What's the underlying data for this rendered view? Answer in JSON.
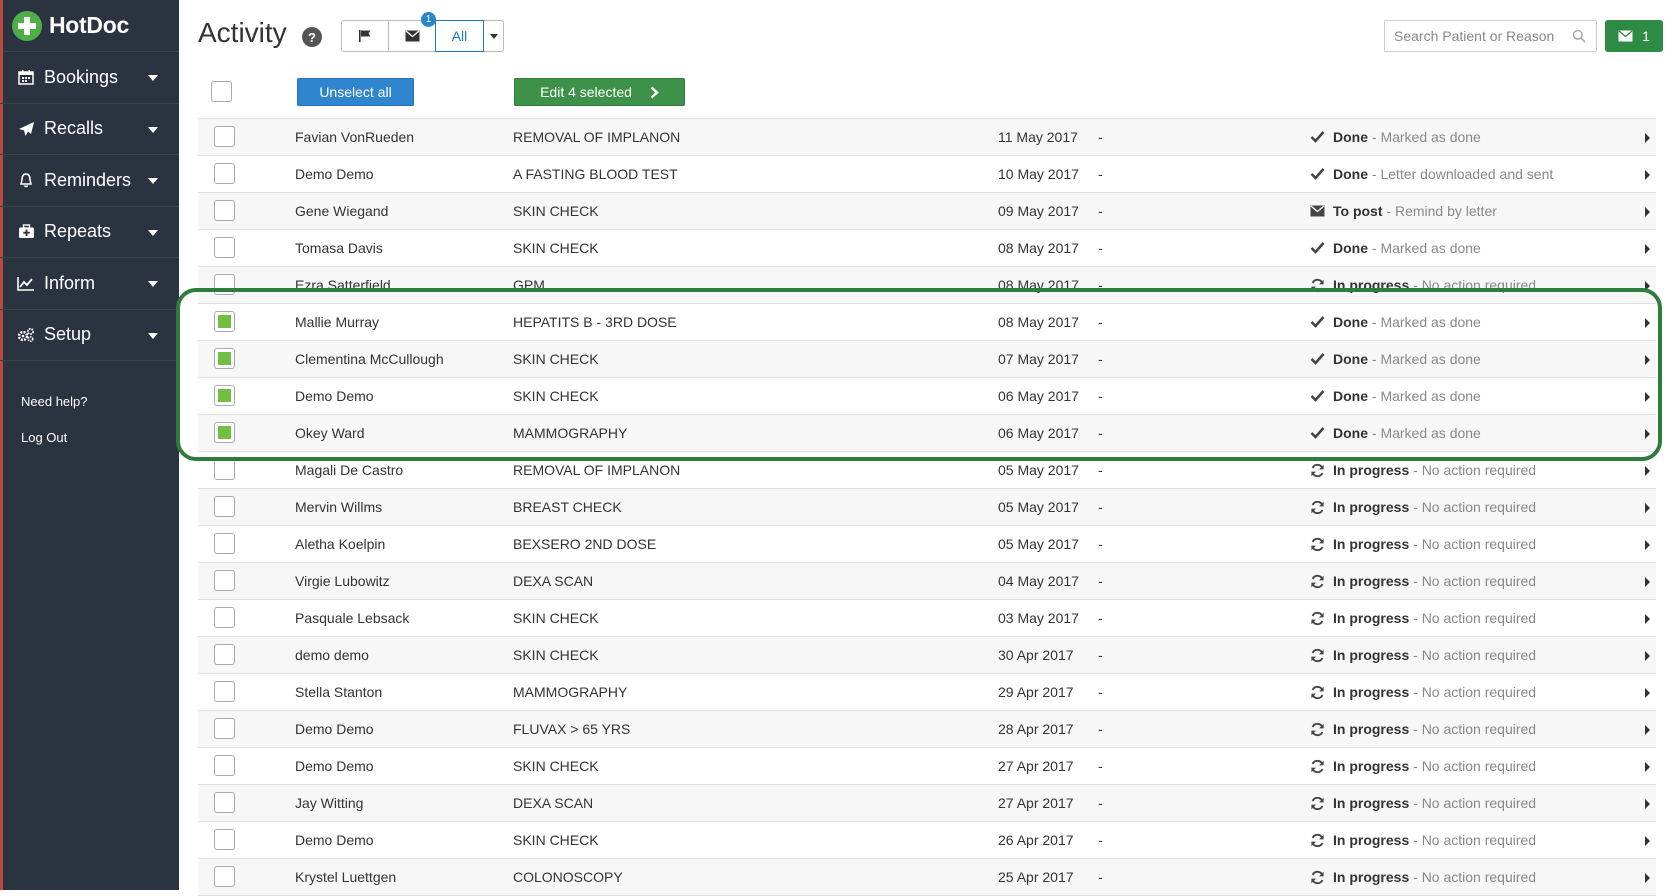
{
  "brand": {
    "name": "HotDoc"
  },
  "sidebar": {
    "items": [
      {
        "label": "Bookings",
        "icon": "calendar-icon"
      },
      {
        "label": "Recalls",
        "icon": "paper-plane-icon"
      },
      {
        "label": "Reminders",
        "icon": "bell-icon"
      },
      {
        "label": "Repeats",
        "icon": "medkit-icon"
      },
      {
        "label": "Inform",
        "icon": "line-chart-icon"
      },
      {
        "label": "Setup",
        "icon": "cogs-icon"
      }
    ],
    "links": [
      {
        "label": "Need help?"
      },
      {
        "label": "Log Out"
      }
    ]
  },
  "header": {
    "title": "Activity",
    "help": "?",
    "filters": {
      "all_label": "All",
      "mail_badge": "1"
    },
    "search_placeholder": "Search Patient or Reason",
    "messages_count": "1"
  },
  "toolbar": {
    "unselect_label": "Unselect all",
    "edit_label": "Edit 4 selected"
  },
  "rows": [
    {
      "checked": false,
      "name": "Favian VonRueden",
      "reason": "REMOVAL OF IMPLANON",
      "date": "11 May 2017",
      "dash": "-",
      "icon": "check-icon",
      "status": "Done",
      "detail": " - Marked as done"
    },
    {
      "checked": false,
      "name": "Demo Demo",
      "reason": "A FASTING BLOOD TEST",
      "date": "10 May 2017",
      "dash": "-",
      "icon": "check-icon",
      "status": "Done",
      "detail": " - Letter downloaded and sent"
    },
    {
      "checked": false,
      "name": "Gene Wiegand",
      "reason": "SKIN CHECK",
      "date": "09 May 2017",
      "dash": "-",
      "icon": "envelope-icon",
      "status": "To post",
      "detail": " - Remind by letter"
    },
    {
      "checked": false,
      "name": "Tomasa Davis",
      "reason": "SKIN CHECK",
      "date": "08 May 2017",
      "dash": "-",
      "icon": "check-icon",
      "status": "Done",
      "detail": " - Marked as done"
    },
    {
      "checked": false,
      "name": "Ezra Satterfield",
      "reason": "GPM",
      "date": "08 May 2017",
      "dash": "-",
      "icon": "refresh-icon",
      "status": "In progress",
      "detail": " - No action required"
    },
    {
      "checked": true,
      "name": "Mallie Murray",
      "reason": "HEPATITS B - 3RD DOSE",
      "date": "08 May 2017",
      "dash": "-",
      "icon": "check-icon",
      "status": "Done",
      "detail": " - Marked as done"
    },
    {
      "checked": true,
      "name": "Clementina McCullough",
      "reason": "SKIN CHECK",
      "date": "07 May 2017",
      "dash": "-",
      "icon": "check-icon",
      "status": "Done",
      "detail": " - Marked as done"
    },
    {
      "checked": true,
      "name": "Demo Demo",
      "reason": "SKIN CHECK",
      "date": "06 May 2017",
      "dash": "-",
      "icon": "check-icon",
      "status": "Done",
      "detail": " - Marked as done"
    },
    {
      "checked": true,
      "name": "Okey Ward",
      "reason": "MAMMOGRAPHY",
      "date": "06 May 2017",
      "dash": "-",
      "icon": "check-icon",
      "status": "Done",
      "detail": " - Marked as done"
    },
    {
      "checked": false,
      "name": "Magali De Castro",
      "reason": "REMOVAL OF IMPLANON",
      "date": "05 May 2017",
      "dash": "-",
      "icon": "refresh-icon",
      "status": "In progress",
      "detail": " - No action required"
    },
    {
      "checked": false,
      "name": "Mervin Willms",
      "reason": "BREAST CHECK",
      "date": "05 May 2017",
      "dash": "-",
      "icon": "refresh-icon",
      "status": "In progress",
      "detail": " - No action required"
    },
    {
      "checked": false,
      "name": "Aletha Koelpin",
      "reason": "BEXSERO 2ND DOSE",
      "date": "05 May 2017",
      "dash": "-",
      "icon": "refresh-icon",
      "status": "In progress",
      "detail": " - No action required"
    },
    {
      "checked": false,
      "name": "Virgie Lubowitz",
      "reason": "DEXA SCAN",
      "date": "04 May 2017",
      "dash": "-",
      "icon": "refresh-icon",
      "status": "In progress",
      "detail": " - No action required"
    },
    {
      "checked": false,
      "name": "Pasquale Lebsack",
      "reason": "SKIN CHECK",
      "date": "03 May 2017",
      "dash": "-",
      "icon": "refresh-icon",
      "status": "In progress",
      "detail": " - No action required"
    },
    {
      "checked": false,
      "name": "demo demo",
      "reason": "SKIN CHECK",
      "date": "30 Apr 2017",
      "dash": "-",
      "icon": "refresh-icon",
      "status": "In progress",
      "detail": " - No action required"
    },
    {
      "checked": false,
      "name": "Stella Stanton",
      "reason": "MAMMOGRAPHY",
      "date": "29 Apr 2017",
      "dash": "-",
      "icon": "refresh-icon",
      "status": "In progress",
      "detail": " - No action required"
    },
    {
      "checked": false,
      "name": "Demo Demo",
      "reason": "FLUVAX > 65 YRS",
      "date": "28 Apr 2017",
      "dash": "-",
      "icon": "refresh-icon",
      "status": "In progress",
      "detail": " - No action required"
    },
    {
      "checked": false,
      "name": "Demo Demo",
      "reason": "SKIN CHECK",
      "date": "27 Apr 2017",
      "dash": "-",
      "icon": "refresh-icon",
      "status": "In progress",
      "detail": " - No action required"
    },
    {
      "checked": false,
      "name": "Jay Witting",
      "reason": "DEXA SCAN",
      "date": "27 Apr 2017",
      "dash": "-",
      "icon": "refresh-icon",
      "status": "In progress",
      "detail": " - No action required"
    },
    {
      "checked": false,
      "name": "Demo Demo",
      "reason": "SKIN CHECK",
      "date": "26 Apr 2017",
      "dash": "-",
      "icon": "refresh-icon",
      "status": "In progress",
      "detail": " - No action required"
    },
    {
      "checked": false,
      "name": "Krystel Luettgen",
      "reason": "COLONOSCOPY",
      "date": "25 Apr 2017",
      "dash": "-",
      "icon": "refresh-icon",
      "status": "In progress",
      "detail": " - No action required"
    }
  ]
}
